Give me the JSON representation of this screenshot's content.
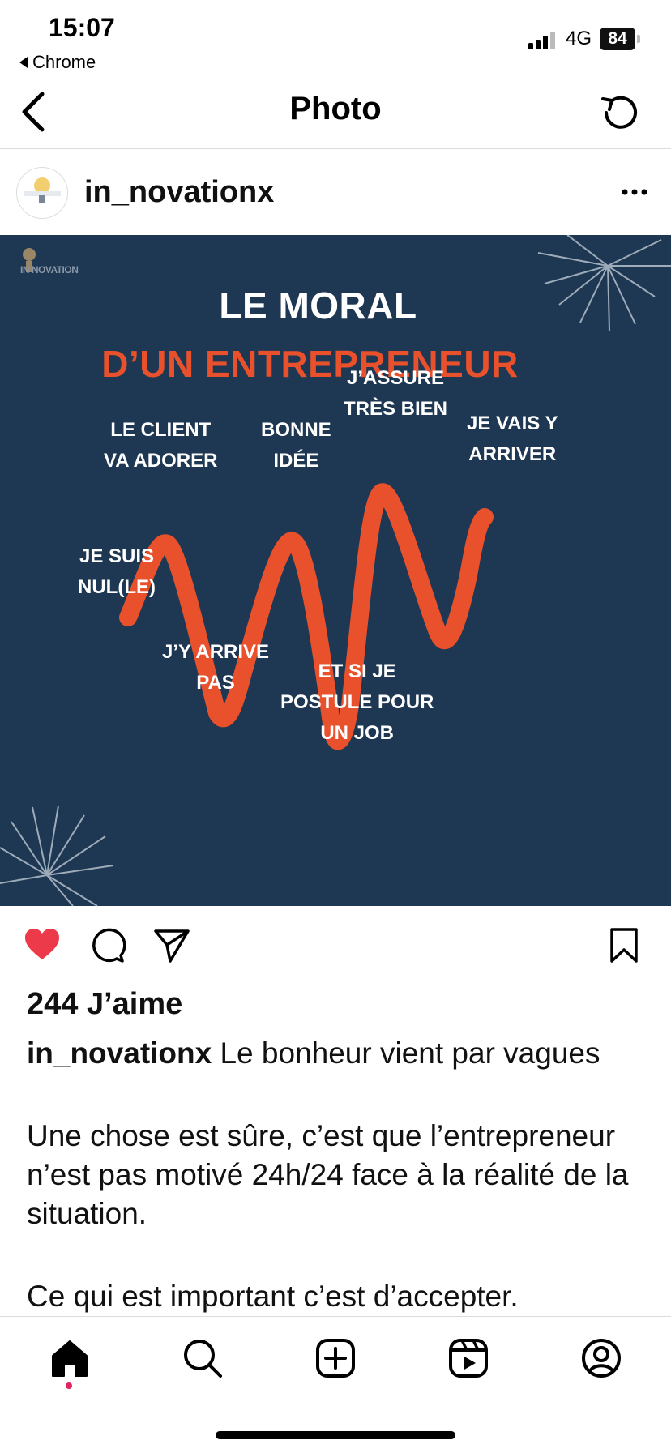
{
  "status_bar": {
    "time": "15:07",
    "back_app": "Chrome",
    "network": "4G",
    "battery": "84"
  },
  "nav": {
    "title": "Photo"
  },
  "post": {
    "username": "in_novationx",
    "image": {
      "logo_text": "IN NOVATION",
      "title": "LE MORAL",
      "subtitle": "D’UN ENTREPRENEUR",
      "labels": {
        "je_suis_nul_1": "JE SUIS",
        "je_suis_nul_2": "NUL(LE)",
        "client_1": "LE CLIENT",
        "client_2": "VA ADORER",
        "jy_arrive_pas_1": "J’Y ARRIVE",
        "jy_arrive_pas_2": "PAS",
        "bonne_idee_1": "BONNE",
        "bonne_idee_2": "IDÉE",
        "et_si_1": "ET SI JE",
        "et_si_2": "POSTULE POUR",
        "et_si_3": "UN JOB",
        "jassure_1": "J’ASSURE",
        "jassure_2": "TRÈS BIEN",
        "je_vais_1": "JE VAIS Y",
        "je_vais_2": "ARRIVER"
      },
      "colors": {
        "background": "#1e3853",
        "accent": "#e8512c"
      }
    },
    "likes": "244 J’aime",
    "caption": {
      "lead": "Le bonheur vient par vagues",
      "paragraph_1": "Une chose est sûre, c’est que l’entrepreneur n’est pas motivé 24h/24 face à la réalité de la situation.",
      "paragraph_2": "Ce qui est important c’est d’accepter."
    }
  },
  "icons": {
    "back": "chevron-left-icon",
    "refresh": "refresh-icon",
    "more": "more-horizontal-icon",
    "like": "heart-filled-icon",
    "comment": "comment-icon",
    "share": "send-icon",
    "save": "bookmark-icon",
    "tabs": [
      "home-icon",
      "search-icon",
      "create-icon",
      "reels-icon",
      "profile-icon"
    ]
  }
}
